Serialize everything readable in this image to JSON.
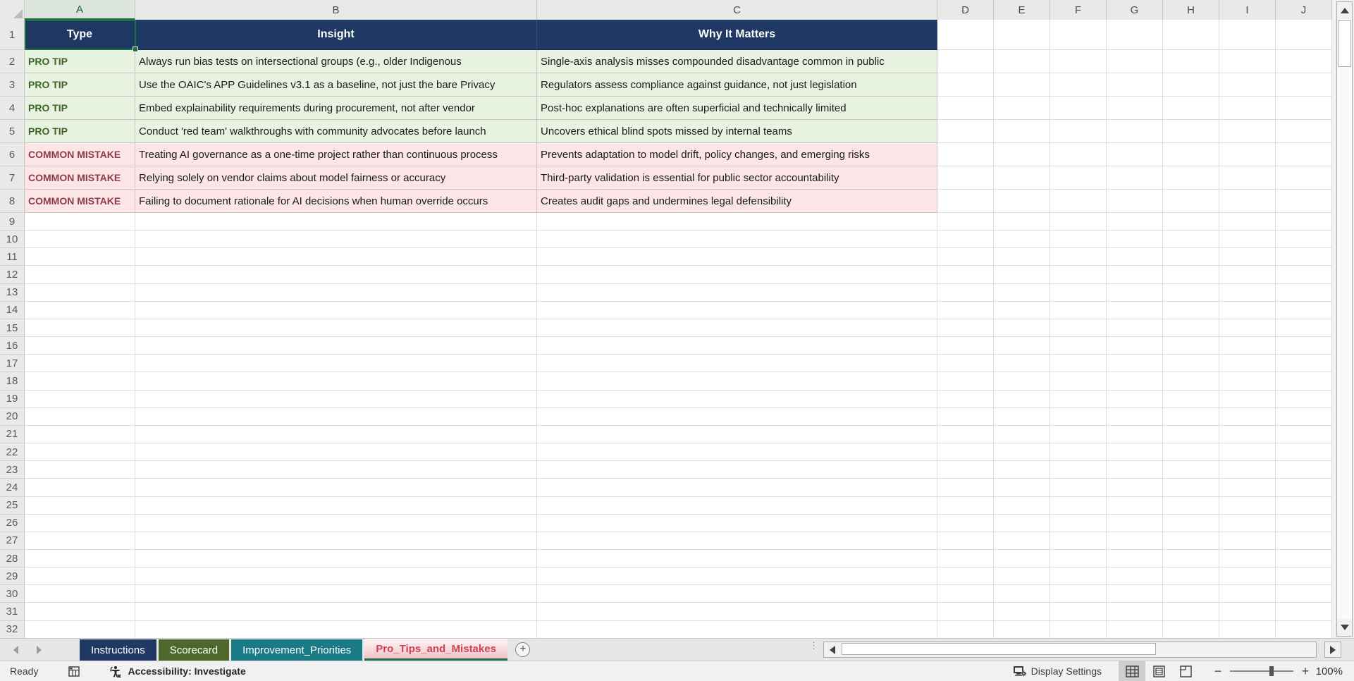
{
  "sheet": {
    "name": "Pro_Tips_and_Mistakes",
    "selected_cell": "A1",
    "columns": [
      "A",
      "B",
      "C",
      "D",
      "E",
      "F",
      "G",
      "H",
      "I",
      "J"
    ],
    "first_row": 1,
    "last_row": 32
  },
  "table": {
    "headers": {
      "type": "Type",
      "insight": "Insight",
      "why": "Why It Matters"
    },
    "rows": [
      {
        "kind": "tip",
        "type": "PRO TIP",
        "insight": "Always run bias tests on intersectional groups (e.g., older Indigenous",
        "why": "Single-axis analysis misses compounded disadvantage common in public"
      },
      {
        "kind": "tip",
        "type": "PRO TIP",
        "insight": "Use the OAIC's APP Guidelines v3.1 as a baseline, not just the bare Privacy",
        "why": "Regulators assess compliance against guidance, not just legislation"
      },
      {
        "kind": "tip",
        "type": "PRO TIP",
        "insight": "Embed explainability requirements during procurement, not after vendor",
        "why": "Post-hoc explanations are often superficial and technically limited"
      },
      {
        "kind": "tip",
        "type": "PRO TIP",
        "insight": "Conduct 'red team' walkthroughs with community advocates before launch",
        "why": "Uncovers ethical blind spots missed by internal teams"
      },
      {
        "kind": "mistake",
        "type": "COMMON MISTAKE",
        "insight": "Treating AI governance as a one-time project rather than continuous process",
        "why": "Prevents adaptation to model drift, policy changes, and emerging risks"
      },
      {
        "kind": "mistake",
        "type": "COMMON MISTAKE",
        "insight": "Relying solely on vendor claims about model fairness or accuracy",
        "why": "Third-party validation is essential for public sector accountability"
      },
      {
        "kind": "mistake",
        "type": "COMMON MISTAKE",
        "insight": "Failing to document rationale for AI decisions when human override occurs",
        "why": "Creates audit gaps and undermines legal defensibility"
      }
    ]
  },
  "sheet_tabs": [
    {
      "label": "Instructions",
      "color": "#1F3864",
      "active": false
    },
    {
      "label": "Scorecard",
      "color": "#4C682B",
      "active": false
    },
    {
      "label": "Improvement_Priorities",
      "color": "#1A7B86",
      "active": false
    },
    {
      "label": "Pro_Tips_and_Mistakes",
      "color": "",
      "active": true
    }
  ],
  "tabbar": {
    "add_sheet_label": "+"
  },
  "status_bar": {
    "ready": "Ready",
    "accessibility": "Accessibility: Investigate",
    "display_settings": "Display Settings",
    "zoom_percent": "100%"
  },
  "colors": {
    "header_fill": "#1F3864",
    "tip_fill": "#E8F2E1",
    "tip_text": "#3D6426",
    "mistake_fill": "#FBE5E6",
    "mistake_text": "#8C3B47",
    "selection_green": "#1E7145",
    "active_tab_text": "#CC4455"
  }
}
